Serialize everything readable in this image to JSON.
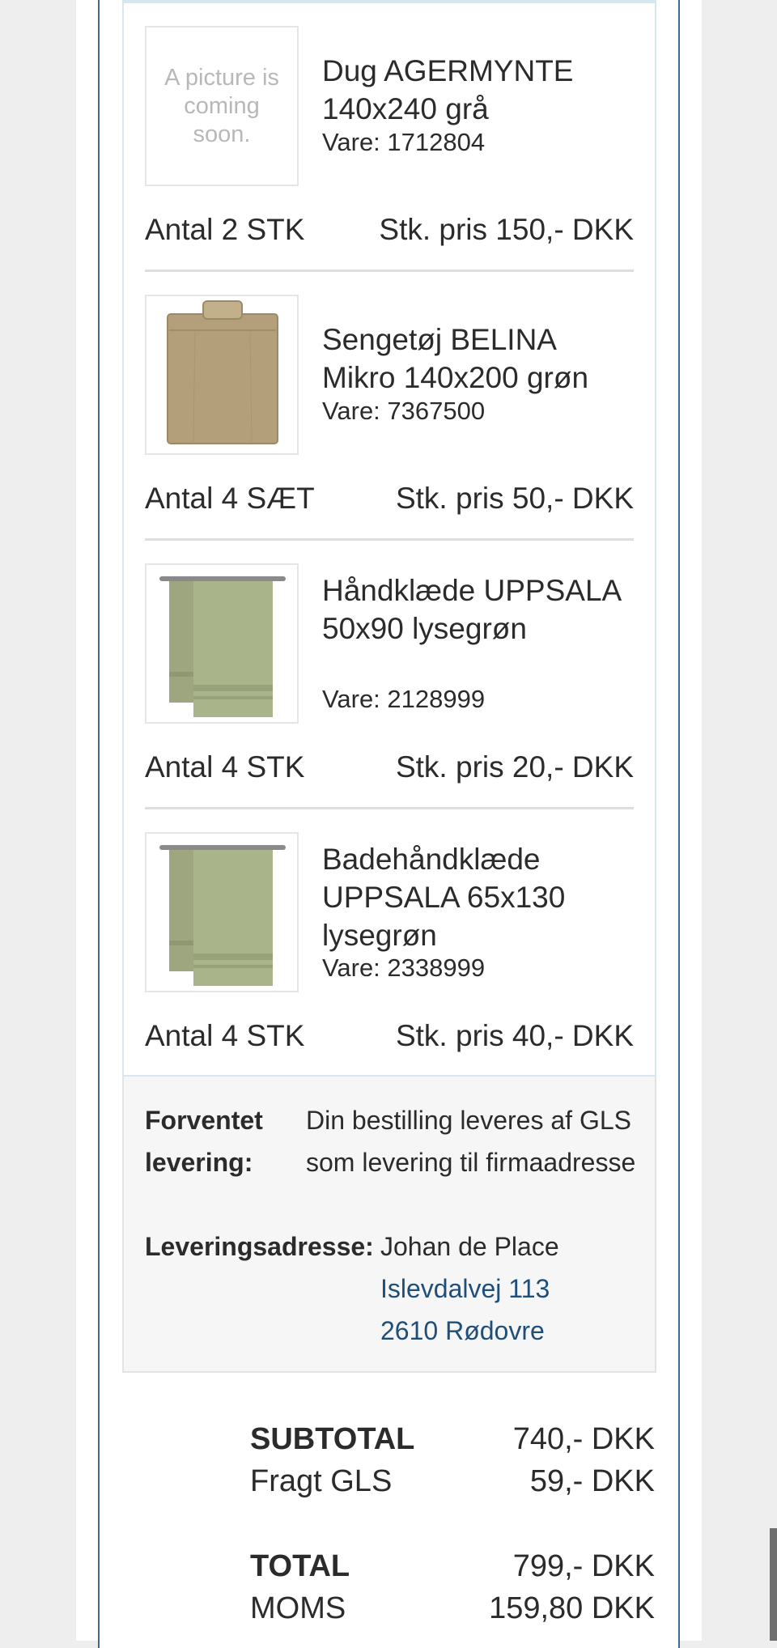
{
  "items": [
    {
      "title": "Dug AGERMYNTE 140x240 grå",
      "sku": "Vare: 1712804",
      "quantity": "Antal 2 STK",
      "unit_price": "Stk. pris 150,- DKK",
      "image": "placeholder",
      "placeholder_text": "A picture is coming soon."
    },
    {
      "title": "Sengetøj BELINA Mikro 140x200 grøn",
      "sku": "Vare: 7367500",
      "quantity": "Antal 4 SÆT",
      "unit_price": "Stk. pris 50,- DKK",
      "image": "bedding-icon"
    },
    {
      "title": "Håndklæde UPPSALA 50x90 lysegrøn",
      "sku": "Vare: 2128999",
      "quantity": "Antal 4 STK",
      "unit_price": "Stk. pris 20,- DKK",
      "image": "towel-icon"
    },
    {
      "title": "Badehåndklæde UPPSALA 65x130 lysegrøn",
      "sku": "Vare: 2338999",
      "quantity": "Antal 4 STK",
      "unit_price": "Stk. pris 40,- DKK",
      "image": "towel-icon"
    }
  ],
  "delivery": {
    "expected_label": "Forventet levering:",
    "expected_text": "Din bestilling leveres af GLS som levering til firmaadresse",
    "address_label": "Leveringsadresse:",
    "address_name": "Johan de Place",
    "address_street": "Islevdalvej 113",
    "address_city": "2610 Rødovre"
  },
  "totals": {
    "subtotal_label": "SUBTOTAL",
    "subtotal_value": "740,- DKK",
    "shipping_label": "Fragt GLS",
    "shipping_value": "59,- DKK",
    "total_label": "TOTAL",
    "total_value": "799,- DKK",
    "vat_label": "MOMS",
    "vat_value": "159,80 DKK"
  },
  "colors": {
    "frame_border": "#3f6a8e",
    "link": "#1f4e79",
    "product_beige": "#b3a07a",
    "product_green": "#a9b48a"
  }
}
